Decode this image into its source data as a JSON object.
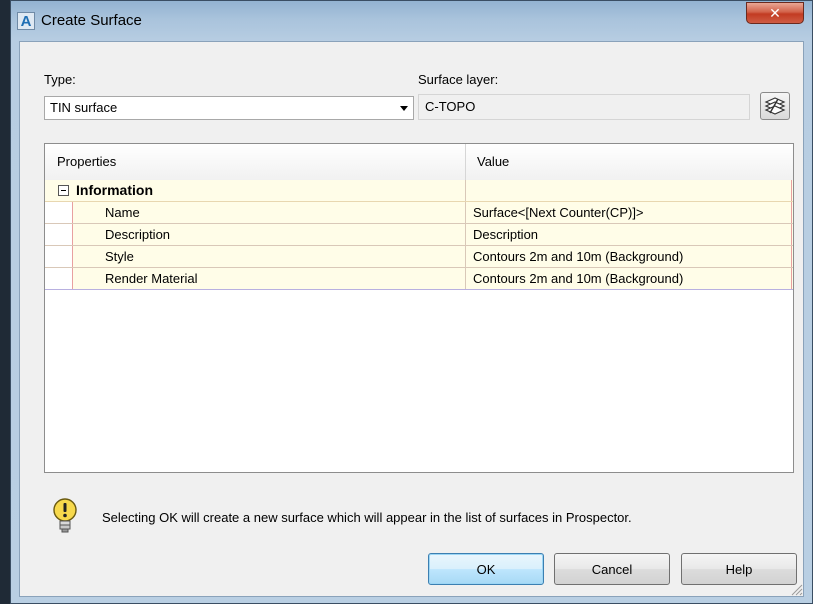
{
  "window": {
    "title": "Create Surface",
    "app_icon_letter": "A",
    "close_glyph": "✕"
  },
  "type": {
    "label": "Type:",
    "value": "TIN surface"
  },
  "surface_layer": {
    "label": "Surface layer:",
    "value": "C-TOPO",
    "button_icon": "layers-icon"
  },
  "grid": {
    "header_properties": "Properties",
    "header_value": "Value",
    "category": {
      "label": "Information",
      "rows": [
        {
          "name": "Name",
          "value": "Surface<[Next Counter(CP)]>"
        },
        {
          "name": "Description",
          "value": "Description"
        },
        {
          "name": "Style",
          "value": "Contours 2m and 10m (Background)"
        },
        {
          "name": "Render Material",
          "value": "Contours 2m and 10m (Background)"
        }
      ]
    }
  },
  "info": {
    "icon": "lightbulb-icon",
    "text": "Selecting OK will create a new surface which will appear in the list of surfaces in Prospector."
  },
  "buttons": {
    "ok": "OK",
    "cancel": "Cancel",
    "help": "Help"
  },
  "colors": {
    "title_gradient": "#a9c3dc",
    "row_background": "#fffde8",
    "close_button": "#c23b22",
    "ok_button": "#bee6fd"
  }
}
